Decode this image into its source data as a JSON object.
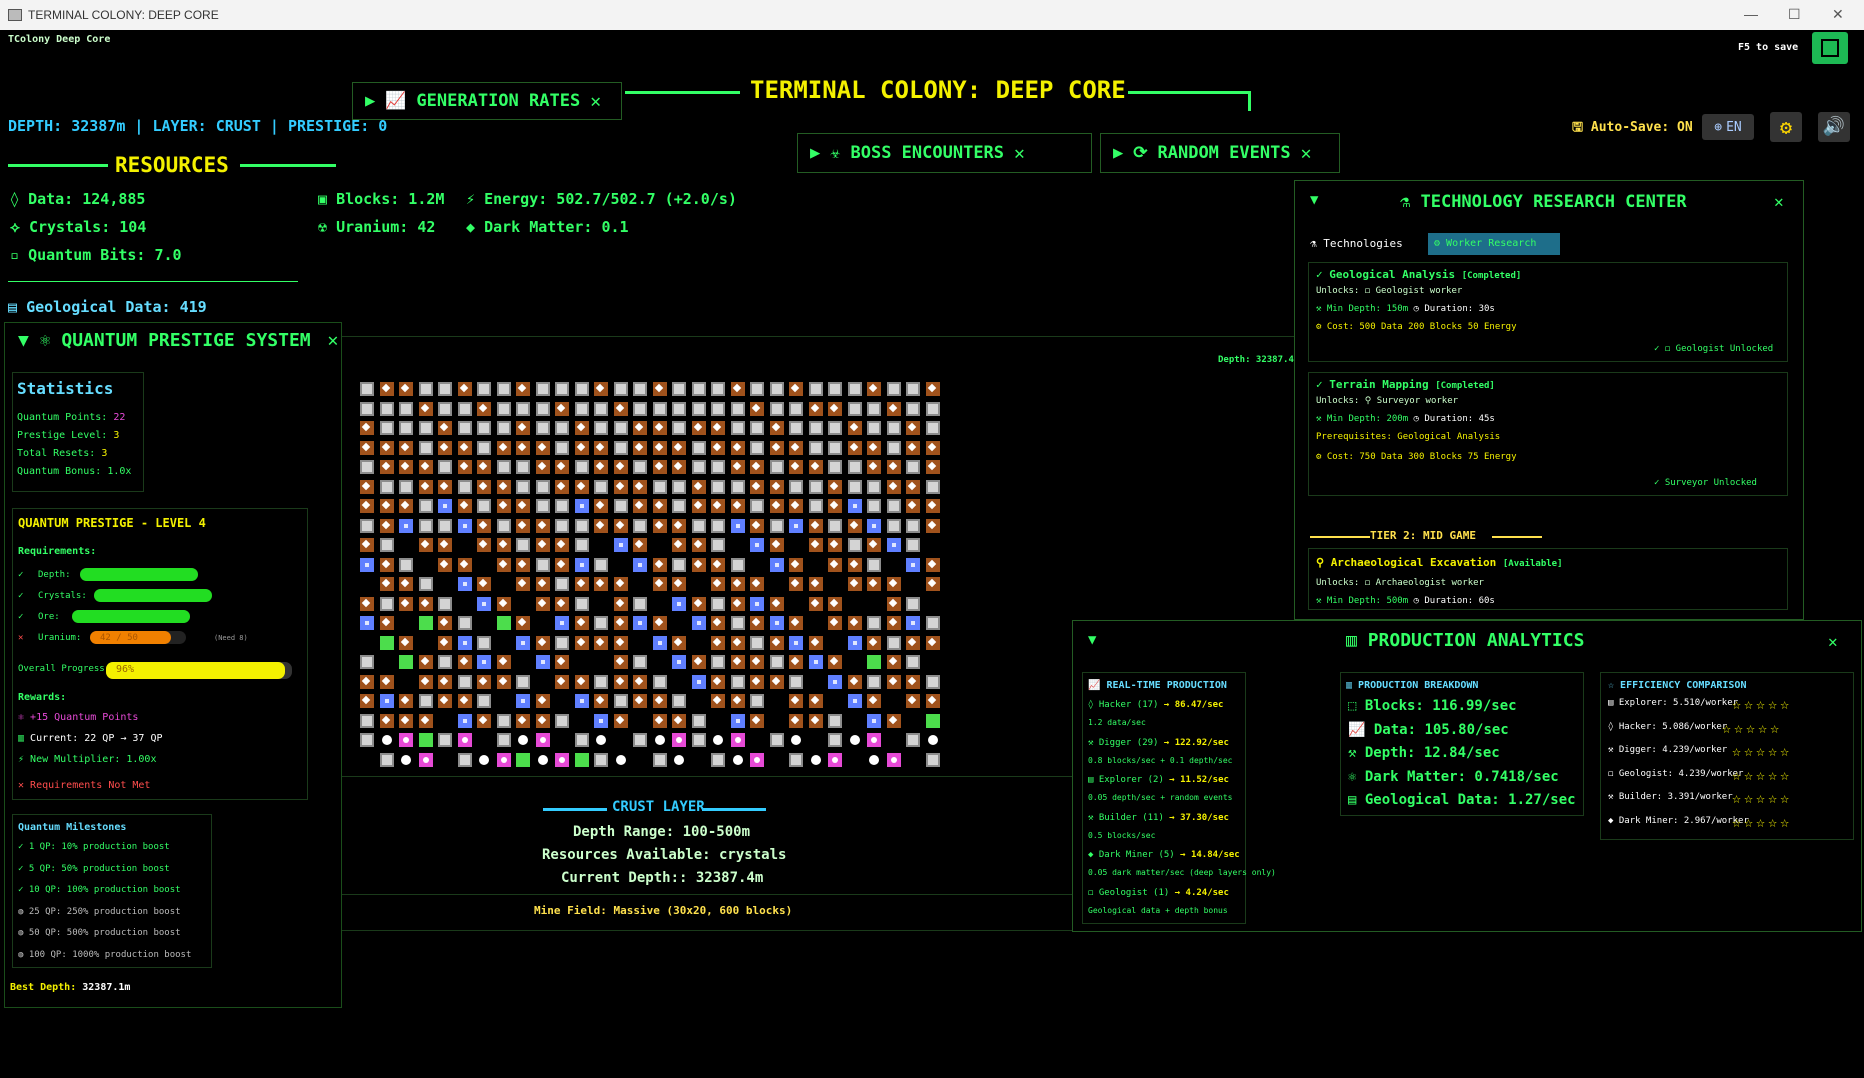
{
  "window": {
    "title": "TERMINAL COLONY: DEEP CORE",
    "app_short": "TColony Deep Core",
    "save_hint": "F5 to save"
  },
  "header": {
    "title": "TERMINAL COLONY: DEEP CORE",
    "status_line": "DEPTH: 32387m | LAYER: CRUST | PRESTIGE: 0",
    "autosave": "Auto-Save: ON",
    "lang": "EN"
  },
  "tabs": {
    "generation": "GENERATION RATES",
    "boss": "BOSS ENCOUNTERS",
    "events": "RANDOM EVENTS"
  },
  "resources": {
    "title": "RESOURCES",
    "data": "Data: 124,885",
    "crystals": "Crystals: 104",
    "qbits": "Quantum Bits: 7.0",
    "blocks": "Blocks: 1.2M",
    "energy": "Energy: 502.7/502.7 (+2.0/s)",
    "uranium": "Uranium: 42",
    "darkmatter": "Dark Matter: 0.1",
    "geodata": "Geological Data: 419"
  },
  "prestige": {
    "title": "QUANTUM PRESTIGE SYSTEM",
    "stats_title": "Statistics",
    "stats": [
      {
        "label": "Quantum Points:",
        "value": "22"
      },
      {
        "label": "Prestige Level:",
        "value": "3"
      },
      {
        "label": "Total Resets:",
        "value": "3"
      },
      {
        "label": "Quantum Bonus:",
        "value": "1.0x"
      }
    ],
    "level_title": "QUANTUM PRESTIGE - LEVEL 4",
    "req_title": "Requirements:",
    "reqs": [
      {
        "mark": "✓",
        "label": "Depth:",
        "fill": 1.0,
        "color": "#22dd22"
      },
      {
        "mark": "✓",
        "label": "Crystals:",
        "fill": 1.0,
        "color": "#22dd22"
      },
      {
        "mark": "✓",
        "label": "Ore:",
        "fill": 1.0,
        "color": "#22dd22"
      },
      {
        "mark": "✕",
        "label": "Uranium:",
        "fill": 0.84,
        "color": "#f08000",
        "text": "42 / 50",
        "need": "(Need 8)"
      }
    ],
    "overall_label": "Overall Progress:",
    "overall_value": "96%",
    "overall_fill": 0.96,
    "rewards_title": "Rewards:",
    "reward_points": "+15 Quantum Points",
    "reward_current": "Current: 22 QP → 37 QP",
    "reward_mult": "New Multiplier: 1.00x",
    "not_met": "Requirements Not Met",
    "milestones_title": "Quantum Milestones",
    "milestones": [
      {
        "mark": "✓",
        "text": "1 QP: 10% production boost"
      },
      {
        "mark": "✓",
        "text": "5 QP: 50% production boost"
      },
      {
        "mark": "✓",
        "text": "10 QP: 100% production boost"
      },
      {
        "mark": "◍",
        "text": "25 QP: 250% production boost"
      },
      {
        "mark": "◍",
        "text": "50 QP: 500% production boost"
      },
      {
        "mark": "◍",
        "text": "100 QP: 1000% production boost"
      }
    ],
    "best_depth_label": "Best Depth:",
    "best_depth": "32387.1m"
  },
  "minefield": {
    "depth_tag": "Depth: 32387.4m",
    "layer_title": "CRUST LAYER",
    "depth_range": "Depth Range: 100-500m",
    "resources_avail": "Resources Available: crystals",
    "current_depth": "Current Depth:: 32387.4m",
    "field_size": "Mine Field: Massive (30x20, 600 blocks)"
  },
  "tech": {
    "title": "TECHNOLOGY RESEARCH CENTER",
    "tab_tech": "Technologies",
    "tab_worker": "Worker Research",
    "cards": [
      {
        "name": "Geological Analysis",
        "status": "[Completed]",
        "unlocks": "Unlocks: ◻ Geologist worker",
        "min": "Min Depth: 150m",
        "dur": "Duration: 30s",
        "prereq": "",
        "cost": "Cost: 500 Data  200 Blocks  50 Energy",
        "done": "◻ Geologist Unlocked"
      },
      {
        "name": "Terrain Mapping",
        "status": "[Completed]",
        "unlocks": "Unlocks: ⚲ Surveyor worker",
        "min": "Min Depth: 200m",
        "dur": "Duration: 45s",
        "prereq": "Prerequisites:  Geological Analysis",
        "cost": "Cost: 750 Data  300 Blocks  75 Energy",
        "done": "Surveyor Unlocked"
      }
    ],
    "tier": "TIER 2: MID GAME",
    "card3": {
      "name": "Archaeological Excavation",
      "status": "[Available]",
      "unlocks": "Unlocks: ◻ Archaeologist worker",
      "min": "Min Depth: 500m",
      "dur": "Duration: 60s"
    }
  },
  "analytics": {
    "title": "PRODUCTION ANALYTICS",
    "rt_title": "REAL-TIME PRODUCTION",
    "rt": [
      {
        "name": "Hacker (17)",
        "rate": "→ 86.47/sec",
        "sub": "1.2 data/sec"
      },
      {
        "name": "Digger (29)",
        "rate": "→ 122.92/sec",
        "sub": "0.8 blocks/sec + 0.1 depth/sec"
      },
      {
        "name": "Explorer (2)",
        "rate": "→ 11.52/sec",
        "sub": "0.05 depth/sec + random events"
      },
      {
        "name": "Builder (11)",
        "rate": "→ 37.30/sec",
        "sub": "0.5 blocks/sec"
      },
      {
        "name": "Dark Miner (5)",
        "rate": "→ 14.84/sec",
        "sub": "0.05 dark matter/sec (deep layers only)"
      },
      {
        "name": "Geologist (1)",
        "rate": "→ 4.24/sec",
        "sub": "Geological data + depth bonus"
      }
    ],
    "bd_title": "PRODUCTION BREAKDOWN",
    "bd": [
      "Blocks: 116.99/sec",
      "Data: 105.80/sec",
      "Depth: 12.84/sec",
      "Dark Matter: 0.7418/sec",
      "Geological Data: 1.27/sec"
    ],
    "eff_title": "EFFICIENCY COMPARISON",
    "eff": [
      {
        "name": "Explorer: 5.510/worker",
        "stars": "☆☆☆☆☆"
      },
      {
        "name": "Hacker: 5.086/worker",
        "stars": "☆☆☆☆☆"
      },
      {
        "name": "Digger: 4.239/worker",
        "stars": "☆☆☆☆☆"
      },
      {
        "name": "Geologist: 4.239/worker",
        "stars": "☆☆☆☆☆"
      },
      {
        "name": "Builder: 3.391/worker",
        "stars": "☆☆☆☆☆"
      },
      {
        "name": "Dark Miner: 2.967/worker",
        "stars": "☆☆☆☆☆"
      }
    ]
  }
}
